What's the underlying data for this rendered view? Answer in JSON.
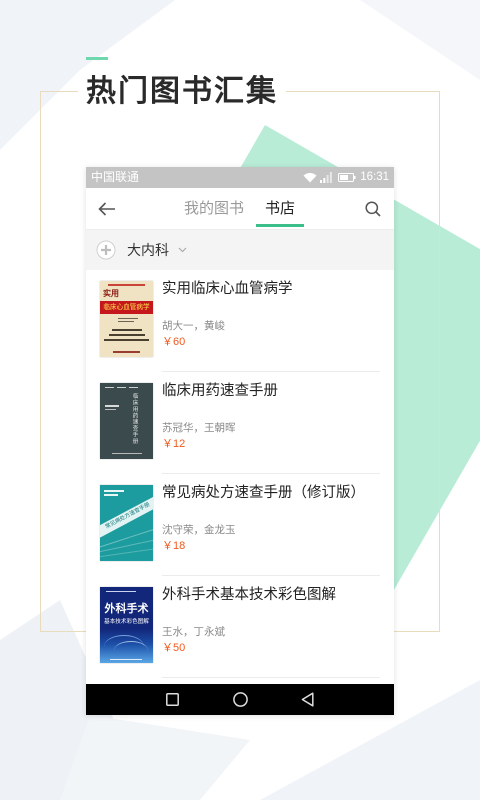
{
  "heading": {
    "title": "热门图书汇集"
  },
  "status_bar": {
    "carrier": "中国联通",
    "time": "16:31"
  },
  "nav": {
    "tabs": [
      {
        "label": "我的图书",
        "active": false
      },
      {
        "label": "书店",
        "active": true
      }
    ]
  },
  "category": {
    "label": "大内科"
  },
  "books": [
    {
      "title": "实用临床心血管病学",
      "authors": "胡大一，黄峻",
      "price": "￥60",
      "cover": {
        "top": "实用",
        "band": "临床心血管病学"
      }
    },
    {
      "title": "临床用药速查手册",
      "authors": "苏冠华，王朝晖",
      "price": "￥12",
      "cover": {
        "vertical": "临床用药速查手册"
      }
    },
    {
      "title": "常见病处方速查手册（修订版）",
      "authors": "沈守荣，金龙玉",
      "price": "￥18",
      "cover": {
        "band": "常见病处方速查手册"
      }
    },
    {
      "title": "外科手术基本技术彩色图解",
      "authors": "王水，丁永斌",
      "price": "￥50",
      "cover": {
        "title": "外科手术",
        "subtitle": "基本技术彩色图解"
      }
    }
  ],
  "icons": {
    "back": "back-arrow-icon",
    "search": "search-icon",
    "category": "plus-circle-icon",
    "dropdown": "chevron-down-icon",
    "status": [
      "wifi-icon",
      "signal-icon",
      "battery-icon"
    ],
    "system_nav": [
      "square-recents-icon",
      "circle-home-icon",
      "triangle-back-icon"
    ]
  },
  "colors": {
    "accent": "#3dbf8c",
    "accent-light": "#6fd7ae",
    "price": "#f25a1e",
    "frame": "#e8dcbd",
    "diamond": "#b8ecd7",
    "status-bar": "#c4c4c4",
    "category-bg": "#f4f4f4",
    "system-nav-bg": "#000000"
  }
}
